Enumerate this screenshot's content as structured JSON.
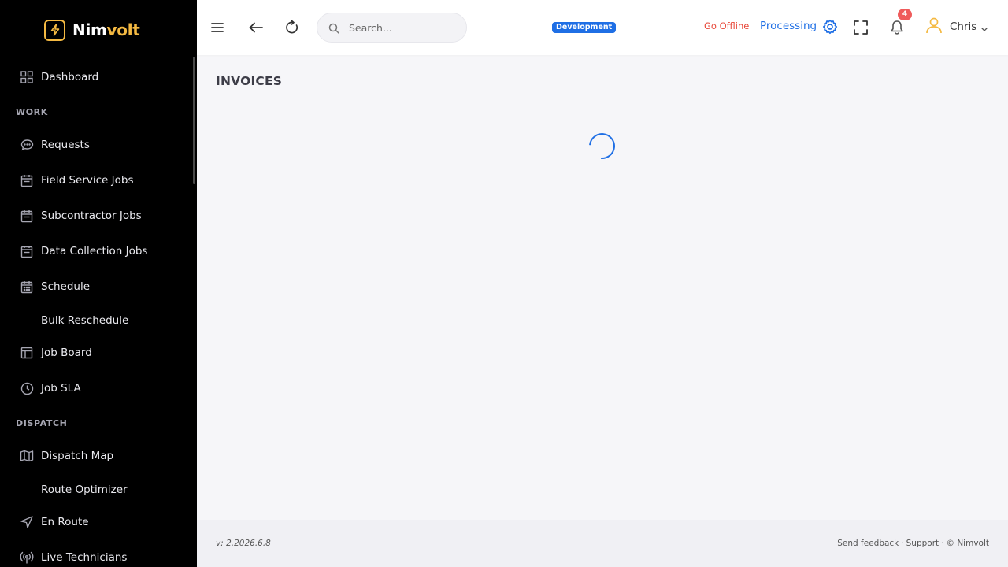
{
  "brand": {
    "name_part1": "Nim",
    "name_part2": "volt",
    "accent": "#f4b942"
  },
  "sidebar": {
    "items": [
      {
        "label": "Dashboard",
        "icon": "grid-icon"
      },
      {
        "section": "WORK"
      },
      {
        "label": "Requests",
        "icon": "chat-bubble-icon"
      },
      {
        "label": "Field Service Jobs",
        "icon": "calendar-icon"
      },
      {
        "label": "Subcontractor Jobs",
        "icon": "calendar-icon"
      },
      {
        "label": "Data Collection Jobs",
        "icon": "calendar-icon"
      },
      {
        "label": "Schedule",
        "icon": "calendar-grid-icon"
      },
      {
        "label": "Bulk Reschedule",
        "icon": ""
      },
      {
        "label": "Job Board",
        "icon": "layout-icon"
      },
      {
        "label": "Job SLA",
        "icon": "clock-icon"
      },
      {
        "section": "DISPATCH"
      },
      {
        "label": "Dispatch Map",
        "icon": "map-icon"
      },
      {
        "label": "Route Optimizer",
        "icon": ""
      },
      {
        "label": "En Route",
        "icon": "navigation-icon"
      },
      {
        "label": "Live Technicians",
        "icon": "broadcast-icon"
      }
    ]
  },
  "header": {
    "search_placeholder": "Search...",
    "environment": "Development",
    "go_offline": "Go Offline",
    "processing": "Processing",
    "notification_count": "4",
    "user_name": "Chris",
    "colors": {
      "primary": "#1f6fe5",
      "danger": "#e8483a",
      "badge": "#ef5b5b",
      "user": "#f4b942"
    }
  },
  "main": {
    "page_title": "INVOICES",
    "loading": true
  },
  "footer": {
    "version": "v: 2.2026.6.8",
    "send_feedback": "Send feedback",
    "separator": "·",
    "support": "Support",
    "copyright": "© Nimvolt"
  }
}
